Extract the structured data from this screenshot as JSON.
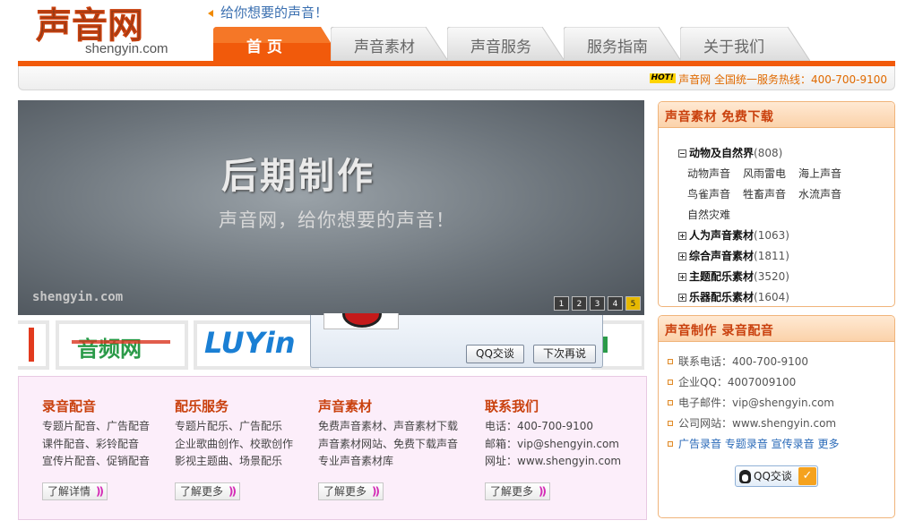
{
  "header": {
    "logo_text": "声音网",
    "logo_url": "shengyin.com",
    "slogan": "给你想要的声音！",
    "nav": [
      {
        "label": "首页",
        "active": true
      },
      {
        "label": "声音素材",
        "active": false
      },
      {
        "label": "声音服务",
        "active": false
      },
      {
        "label": "服务指南",
        "active": false
      },
      {
        "label": "关于我们",
        "active": false
      }
    ],
    "hot_badge": "HOT!",
    "hotline": "声音网 全国统一服务热线：400-700-9100"
  },
  "banner": {
    "title": "后期制作",
    "subtitle": "声音网，给你想要的声音！",
    "watermark": "shengyin.com",
    "pages": [
      "1",
      "2",
      "3",
      "4",
      "5"
    ],
    "active_page": "5"
  },
  "partners": {
    "p2_text": "音频网",
    "p3_text": "LUYin"
  },
  "qq_popup": {
    "chat_button": "QQ交谈",
    "later_button": "下次再说"
  },
  "services": [
    {
      "title": "录音配音",
      "lines": [
        "专题片配音、广告配音",
        "课件配音、彩铃配音",
        "宣传片配音、促销配音"
      ],
      "button": "了解详情"
    },
    {
      "title": "配乐服务",
      "lines": [
        "专题片配乐、广告配乐",
        "企业歌曲创作、校歌创作",
        "影视主题曲、场景配乐"
      ],
      "button": "了解更多"
    },
    {
      "title": "声音素材",
      "lines": [
        "免费声音素材、声音素材下载",
        "声音素材网站、免费下载声音",
        "专业声音素材库"
      ],
      "button": "了解更多"
    },
    {
      "title": "联系我们",
      "lines": [
        "电话：400-700-9100",
        "邮箱：vip@shengyin.com",
        "网址：www.shengyin.com"
      ],
      "button": "了解更多"
    }
  ],
  "sidebar": {
    "materials": {
      "heading": "声音素材  免费下载",
      "expanded": {
        "label": "动物及自然界",
        "count": "(808)",
        "children": [
          "动物声音",
          "风雨雷电",
          "海上声音",
          "鸟雀声音",
          "牲畜声音",
          "水流声音",
          "自然灾难"
        ]
      },
      "collapsed": [
        {
          "label": "人为声音素材",
          "count": "(1063)"
        },
        {
          "label": "综合声音素材",
          "count": "(1811)"
        },
        {
          "label": "主题配乐素材",
          "count": "(3520)"
        },
        {
          "label": "乐器配乐素材",
          "count": "(1604)"
        }
      ]
    },
    "production": {
      "heading": "声音制作  录音配音",
      "contacts": [
        "联系电话：400-700-9100",
        "企业QQ：4007009100",
        "电子邮件：vip@shengyin.com",
        "公司网站：www.shengyin.com"
      ],
      "links": "广告录音 专题录音 宣传录音 更多",
      "qq_button": "QQ交谈"
    }
  },
  "colors": {
    "brand_orange": "#f15a0b",
    "heading_red": "#c9400d",
    "link_blue": "#2a6ab8"
  }
}
